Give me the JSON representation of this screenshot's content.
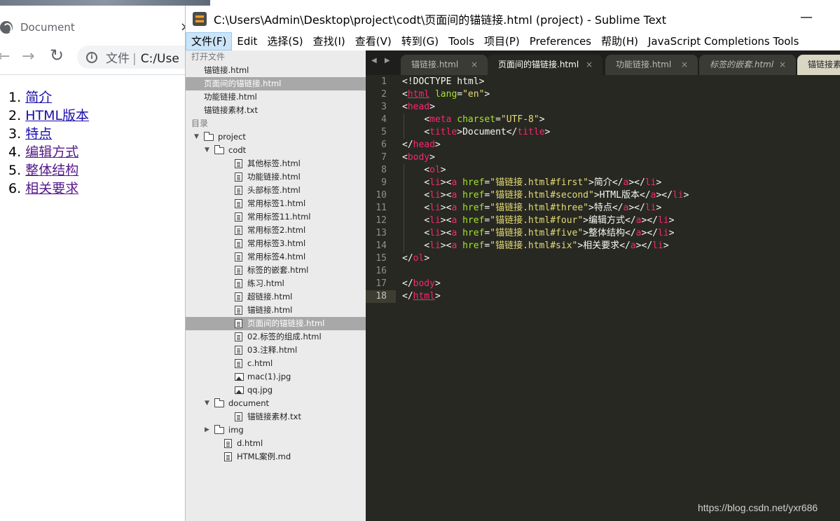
{
  "browser": {
    "tab_title": "Document",
    "tab_close": "×",
    "nav": {
      "back": "←",
      "forward": "→",
      "reload": "↻"
    },
    "omnibox": {
      "info": "i",
      "scheme_label": "文件",
      "separator": "|",
      "url_fragment": "C:/Use"
    },
    "list": [
      {
        "num": "1.",
        "text": "简介"
      },
      {
        "num": "2.",
        "text": "HTML版本"
      },
      {
        "num": "3.",
        "text": "特点"
      },
      {
        "num": "4.",
        "text": "编辑方式"
      },
      {
        "num": "5.",
        "text": "整体结构"
      },
      {
        "num": "6.",
        "text": "相关要求"
      }
    ]
  },
  "sublime": {
    "window_title": "C:\\Users\\Admin\\Desktop\\project\\codt\\页面间的锚链接.html (project) - Sublime Text",
    "minimize": "—",
    "menu": [
      "文件(F)",
      "Edit",
      "选择(S)",
      "查找(I)",
      "查看(V)",
      "转到(G)",
      "Tools",
      "项目(P)",
      "Preferences",
      "帮助(H)",
      "JavaScript Completions Tools"
    ],
    "sidebar": {
      "open_files_header": "打开文件",
      "open_files": [
        "锚链接.html",
        "页面间的锚链接.html",
        "功能链接.html",
        "锚链接素材.txt"
      ],
      "folders_header": "目录",
      "tree": [
        {
          "label": "project",
          "type": "folder",
          "arrow": "▼",
          "depth": 0
        },
        {
          "label": "codt",
          "type": "folder",
          "arrow": "▼",
          "depth": 1
        },
        {
          "label": "其他标签.html",
          "type": "file",
          "depth": 2
        },
        {
          "label": "功能链接.html",
          "type": "file",
          "depth": 2
        },
        {
          "label": "头部标签.html",
          "type": "file",
          "depth": 2
        },
        {
          "label": "常用标签1.html",
          "type": "file",
          "depth": 2
        },
        {
          "label": "常用标签11.html",
          "type": "file",
          "depth": 2
        },
        {
          "label": "常用标签2.html",
          "type": "file",
          "depth": 2
        },
        {
          "label": "常用标签3.html",
          "type": "file",
          "depth": 2
        },
        {
          "label": "常用标签4.html",
          "type": "file",
          "depth": 2
        },
        {
          "label": "标签的嵌套.html",
          "type": "file",
          "depth": 2
        },
        {
          "label": "练习.html",
          "type": "file",
          "depth": 2
        },
        {
          "label": "超链接.html",
          "type": "file",
          "depth": 2
        },
        {
          "label": "锚链接.html",
          "type": "file",
          "depth": 2
        },
        {
          "label": "页面间的锚链接.html",
          "type": "file",
          "depth": 2,
          "selected": true
        },
        {
          "label": "02.标签的组成.html",
          "type": "file",
          "depth": 2
        },
        {
          "label": "03.注释.html",
          "type": "file",
          "depth": 2
        },
        {
          "label": "c.html",
          "type": "file",
          "depth": 2
        },
        {
          "label": "mac(1).jpg",
          "type": "image",
          "depth": 2
        },
        {
          "label": "qq.jpg",
          "type": "image",
          "depth": 2
        },
        {
          "label": "document",
          "type": "folder",
          "arrow": "▼",
          "depth": 1
        },
        {
          "label": "锚链接素材.txt",
          "type": "file",
          "depth": 2
        },
        {
          "label": "img",
          "type": "folder",
          "arrow": "▶",
          "depth": 1
        },
        {
          "label": "d.html",
          "type": "file",
          "depth": 1
        },
        {
          "label": "HTML案例.md",
          "type": "file",
          "depth": 1
        }
      ]
    },
    "tab_scroll": "◀ ▶",
    "tabs": [
      {
        "label": "锚链接.html",
        "close": "×"
      },
      {
        "label": "页面间的锚链接.html",
        "close": "×",
        "active": true
      },
      {
        "label": "功能链接.html",
        "close": "×"
      },
      {
        "label": "标签的嵌套.html",
        "close": "×",
        "italic": true
      },
      {
        "label": "锚链接素",
        "close": ""
      }
    ],
    "code": {
      "line_numbers": [
        "1",
        "2",
        "3",
        "4",
        "5",
        "6",
        "7",
        "8",
        "9",
        "10",
        "11",
        "12",
        "13",
        "14",
        "15",
        "16",
        "17",
        "18"
      ],
      "current_line": 18,
      "lines": [
        "<!DOCTYPE html>",
        "<html lang=\"en\">",
        "<head>",
        "    <meta charset=\"UTF-8\">",
        "    <title>Document</title>",
        "</head>",
        "<body>",
        "    <ol>",
        "    <li><a href=\"锚链接.html#first\">简介</a></li>",
        "    <li><a href=\"锚链接.html#second\">HTML版本</a></li>",
        "    <li><a href=\"锚链接.html#three\">特点</a></li>",
        "    <li><a href=\"锚链接.html#four\">编辑方式</a></li>",
        "    <li><a href=\"锚链接.html#five\">整体结构</a></li>",
        "    <li><a href=\"锚链接.html#six\">相关要求</a></li>",
        "</ol>",
        "",
        "</body>",
        "</html>"
      ]
    },
    "colors": {
      "editor_bg": "#272822",
      "tag": "#f92672",
      "attr": "#a6e22e",
      "string": "#e6db74",
      "text": "#f8f8f2",
      "sidebar_bg": "#ebebeb"
    }
  },
  "watermark": "https://blog.csdn.net/yxr686"
}
